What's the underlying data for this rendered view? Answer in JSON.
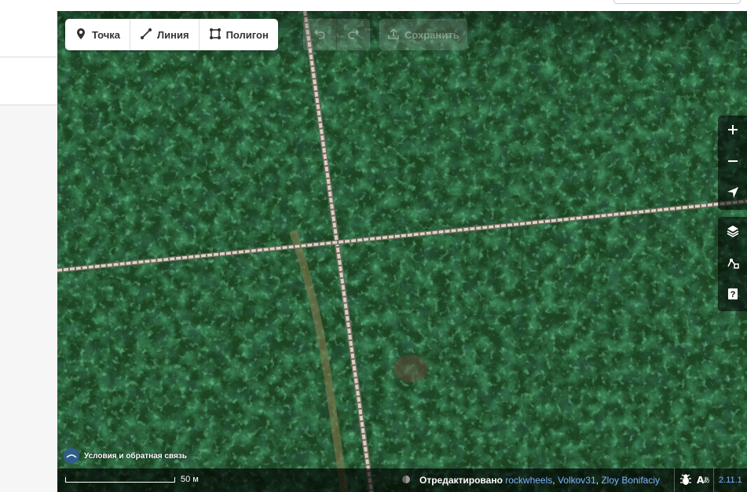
{
  "toolbar": {
    "modes": [
      {
        "label": "Точка",
        "icon": "point-marker-icon"
      },
      {
        "label": "Линия",
        "icon": "line-icon"
      },
      {
        "label": "Полигон",
        "icon": "polygon-icon"
      }
    ],
    "undo_icon": "undo-icon",
    "redo_icon": "redo-icon",
    "save_label": "Сохранить"
  },
  "map_controls": {
    "zoom_in": "zoom-in-icon",
    "zoom_out": "zoom-out-icon",
    "geolocate": "geolocate-icon",
    "layers": "layers-icon",
    "map_data": "map-data-icon",
    "help": "help-icon"
  },
  "attribution": {
    "text": "Условия и обратная связь"
  },
  "footer": {
    "scale_label": "50 м",
    "edited_label": "Отредактировано",
    "editors": [
      "rockwheels",
      "Volkov31",
      "Zloy Bonifaciy"
    ],
    "version": "2.11.1"
  },
  "colors": {
    "link": "#7fb3ff",
    "forest": "#1f4a22",
    "track": "#cfc8b8"
  }
}
